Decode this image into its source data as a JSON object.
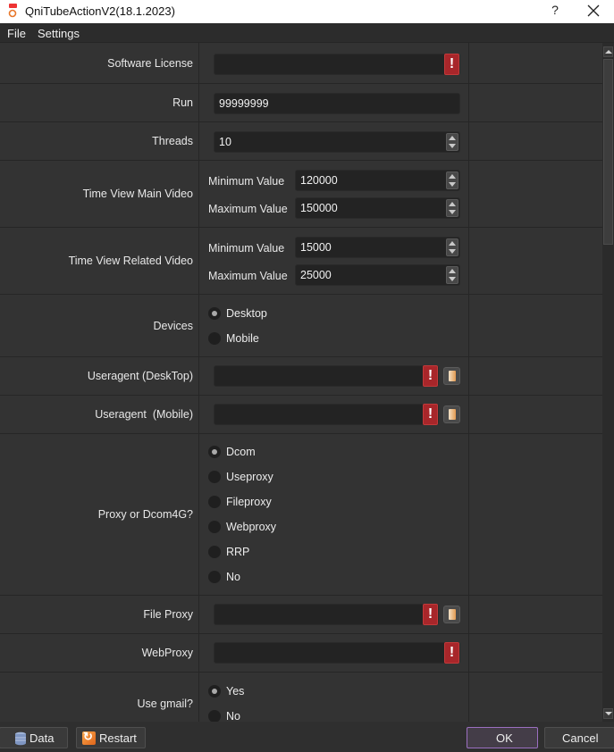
{
  "window": {
    "title": "QniTubeActionV2(18.1.2023)",
    "help_label": "?",
    "close_icon": "close-icon"
  },
  "menu": {
    "items": [
      "File",
      "Settings"
    ]
  },
  "form": {
    "software_license": {
      "label": "Software License",
      "value": "",
      "warning": "!"
    },
    "run": {
      "label": "Run",
      "value": "99999999"
    },
    "threads": {
      "label": "Threads",
      "value": "10"
    },
    "time_view_main": {
      "label": "Time View Main Video",
      "min_label": "Minimum Value",
      "min_value": "120000",
      "max_label": "Maximum Value",
      "max_value": "150000"
    },
    "time_view_related": {
      "label": "Time View Related Video",
      "min_label": "Minimum Value",
      "min_value": "15000",
      "max_label": "Maximum Value",
      "max_value": "25000"
    },
    "devices": {
      "label": "Devices",
      "options": [
        "Desktop",
        "Mobile"
      ],
      "selected": "Desktop"
    },
    "useragent_desktop": {
      "label": "Useragent (DeskTop)",
      "value": "",
      "warning": "!"
    },
    "useragent_mobile": {
      "label": "Useragent  (Mobile)",
      "value": "",
      "warning": "!"
    },
    "proxy": {
      "label": "Proxy or Dcom4G?",
      "options": [
        "Dcom",
        "Useproxy",
        "Fileproxy",
        "Webproxy",
        "RRP",
        "No"
      ],
      "selected": "Dcom"
    },
    "file_proxy": {
      "label": "File Proxy",
      "value": "",
      "warning": "!"
    },
    "web_proxy": {
      "label": "WebProxy",
      "value": "",
      "warning": "!"
    },
    "use_gmail": {
      "label": "Use gmail?",
      "options": [
        "Yes",
        "No"
      ],
      "selected": "Yes"
    }
  },
  "buttons": {
    "data": "Data",
    "restart": "Restart",
    "ok": "OK",
    "cancel": "Cancel"
  },
  "colors": {
    "warning": "#a8262a",
    "ok_border": "#9b6fc0",
    "background": "#333333"
  }
}
